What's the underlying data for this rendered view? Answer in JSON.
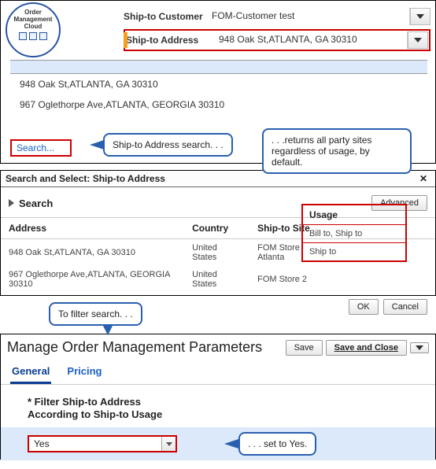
{
  "logo": {
    "line1": "Order",
    "line2": "Management",
    "line3": "Cloud"
  },
  "header": {
    "customer_label": "Ship-to Customer",
    "customer_value": "FOM-Customer test",
    "address_label": "Ship-to Address",
    "address_value": "948 Oak St,ATLANTA, GA 30310"
  },
  "dropdown": {
    "item1": "948 Oak St,ATLANTA, GA 30310",
    "item2": "967 Oglethorpe Ave,ATLANTA, GEORGIA 30310",
    "search_link": "Search..."
  },
  "callouts": {
    "c1": "Ship-to Address search. . .",
    "c2": ". . .returns all party sites regardless of usage, by default.",
    "c3": "To filter search. . .",
    "c4": ". . . set to Yes."
  },
  "dialog": {
    "title": "Search and Select: Ship-to Address",
    "search_label": "Search",
    "advanced_btn": "Advanced",
    "cols": {
      "address": "Address",
      "country": "Country",
      "site": "Ship-to Site",
      "usage": "Usage"
    },
    "rows": [
      {
        "address": "948 Oak St,ATLANTA, GA 30310",
        "country": "United States",
        "site": "FOM Store Atlanta",
        "usage": "Bill to, Ship to"
      },
      {
        "address": "967 Oglethorpe Ave,ATLANTA, GEORGIA 30310",
        "country": "United States",
        "site": "FOM Store 2",
        "usage": "Ship to"
      }
    ],
    "ok": "OK",
    "cancel": "Cancel"
  },
  "params_page": {
    "title": "Manage Order Management Parameters",
    "save": "Save",
    "save_close": "Save and Close",
    "tabs": {
      "general": "General",
      "pricing": "Pricing"
    },
    "param_label_l1": "* Filter Ship-to Address",
    "param_label_l2": "According to Ship-to Usage",
    "value": "Yes"
  }
}
